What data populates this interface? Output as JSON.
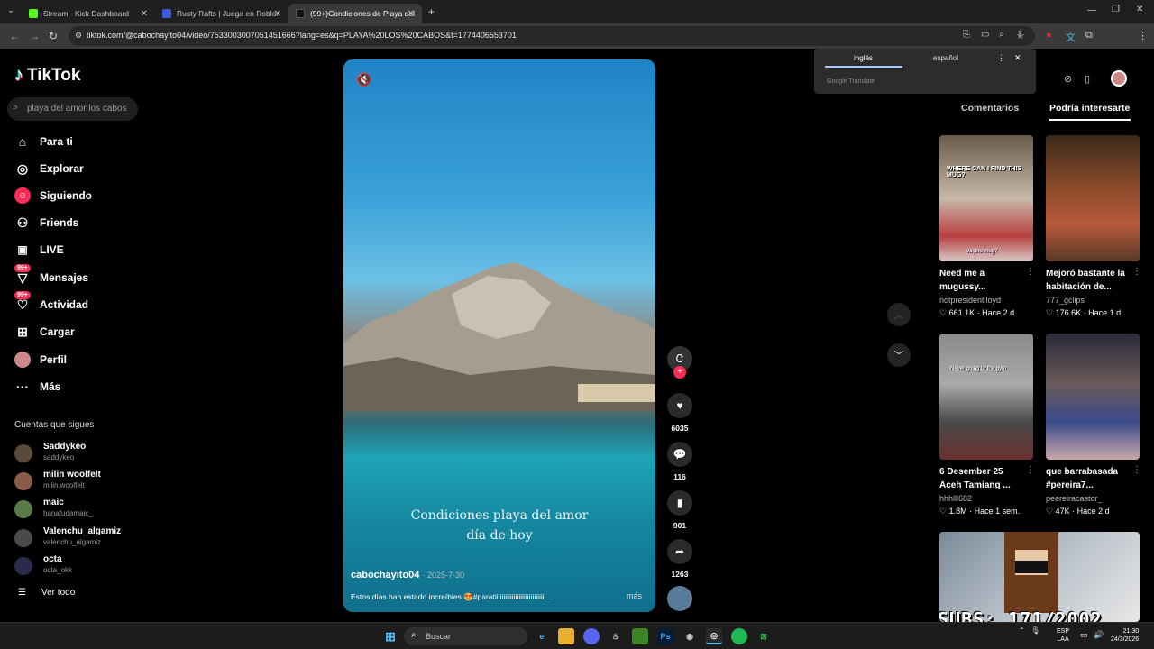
{
  "browser": {
    "tabs": [
      {
        "title": "Stream - Kick Dashboard",
        "color": "#53fc18"
      },
      {
        "title": "Rusty Rafts | Juega en Roblox",
        "color": "#3b5bdb"
      },
      {
        "title": "(99+)Condiciones de Playa del",
        "color": "#111111"
      }
    ],
    "url": "tiktok.com/@cabochayito04/video/7533003007051451666?lang=es&q=PLAYA%20LOS%20CABOS&t=1774406553701"
  },
  "translate_popup": {
    "lang_from": "inglés",
    "lang_to": "español",
    "provider": "Google Translate"
  },
  "sidebar": {
    "logo": "TikTok",
    "search_placeholder": "playa del amor los cabos",
    "nav": [
      {
        "label": "Para ti",
        "icon": "home-icon"
      },
      {
        "label": "Explorar",
        "icon": "compass-icon"
      },
      {
        "label": "Siguiendo",
        "icon": "following-icon"
      },
      {
        "label": "Friends",
        "icon": "friends-icon"
      },
      {
        "label": "LIVE",
        "icon": "live-icon"
      },
      {
        "label": "Mensajes",
        "icon": "messages-icon",
        "badge": "99+"
      },
      {
        "label": "Actividad",
        "icon": "activity-icon",
        "badge": "99+"
      },
      {
        "label": "Cargar",
        "icon": "upload-icon"
      },
      {
        "label": "Perfil",
        "icon": "profile-icon"
      },
      {
        "label": "Más",
        "icon": "more-icon"
      }
    ],
    "following_title": "Cuentas que sigues",
    "following": [
      {
        "name": "Saddykeo",
        "handle": "saddykeo",
        "color": "#5a4a3a"
      },
      {
        "name": "milin woolfelt",
        "handle": "milin.woolfelt",
        "color": "#8a5a4a"
      },
      {
        "name": "maic",
        "handle": "hanafudamaic_",
        "color": "#5a7a4a"
      },
      {
        "name": "Valenchu_algamiz",
        "handle": "valenchu_algamiz",
        "color": "#4a4a4a"
      },
      {
        "name": "octa",
        "handle": "octa_okk",
        "color": "#2a2a4a"
      }
    ],
    "see_all": "Ver todo"
  },
  "video": {
    "overlay_line1": "Condiciones playa del amor",
    "overlay_line2": "día de hoy",
    "author": "cabochayito04",
    "date": "· 2025-7-30",
    "description": "Estos días han estado increíbles 😍#paratiiiiiiiiiiiiiiiiiiiiiiiiiiiii ...",
    "more": "más",
    "likes": "6035",
    "comments": "116",
    "saves": "901",
    "shares": "1263"
  },
  "right_panel": {
    "tab_comments": "Comentarios",
    "tab_suggestions": "Podría interesarte",
    "cards": [
      {
        "title": "Need me a mugussy...",
        "user": "notpresidentlloyd",
        "stats": "♡ 661.1K · Hace 2 d",
        "thumb_text": "WHERE CAN I FIND THIS MUG?",
        "thumb_text2": "vagino mug?"
      },
      {
        "title": "Mejoró bastante la habitación de...",
        "user": "777_gclips",
        "stats": "♡ 176.6K · Hace 1 d"
      },
      {
        "title": "6 Desember 25 Aceh Tamiang ...",
        "user": "hhhlll682",
        "stats": "♡ 1.8M · Hace 1 sem.",
        "thumb_text": "Never going to the gym"
      },
      {
        "title": "que barrabasada #pereira7...",
        "user": "peereiracastor_",
        "stats": "♡ 47K · Hace 2 d"
      }
    ],
    "subs_overlay": "SUBS: 171/2002"
  },
  "taskbar": {
    "search": "Buscar",
    "lang_top": "ESP",
    "lang_bottom": "LAA",
    "time": "21:30",
    "date": "24/3/2026"
  }
}
